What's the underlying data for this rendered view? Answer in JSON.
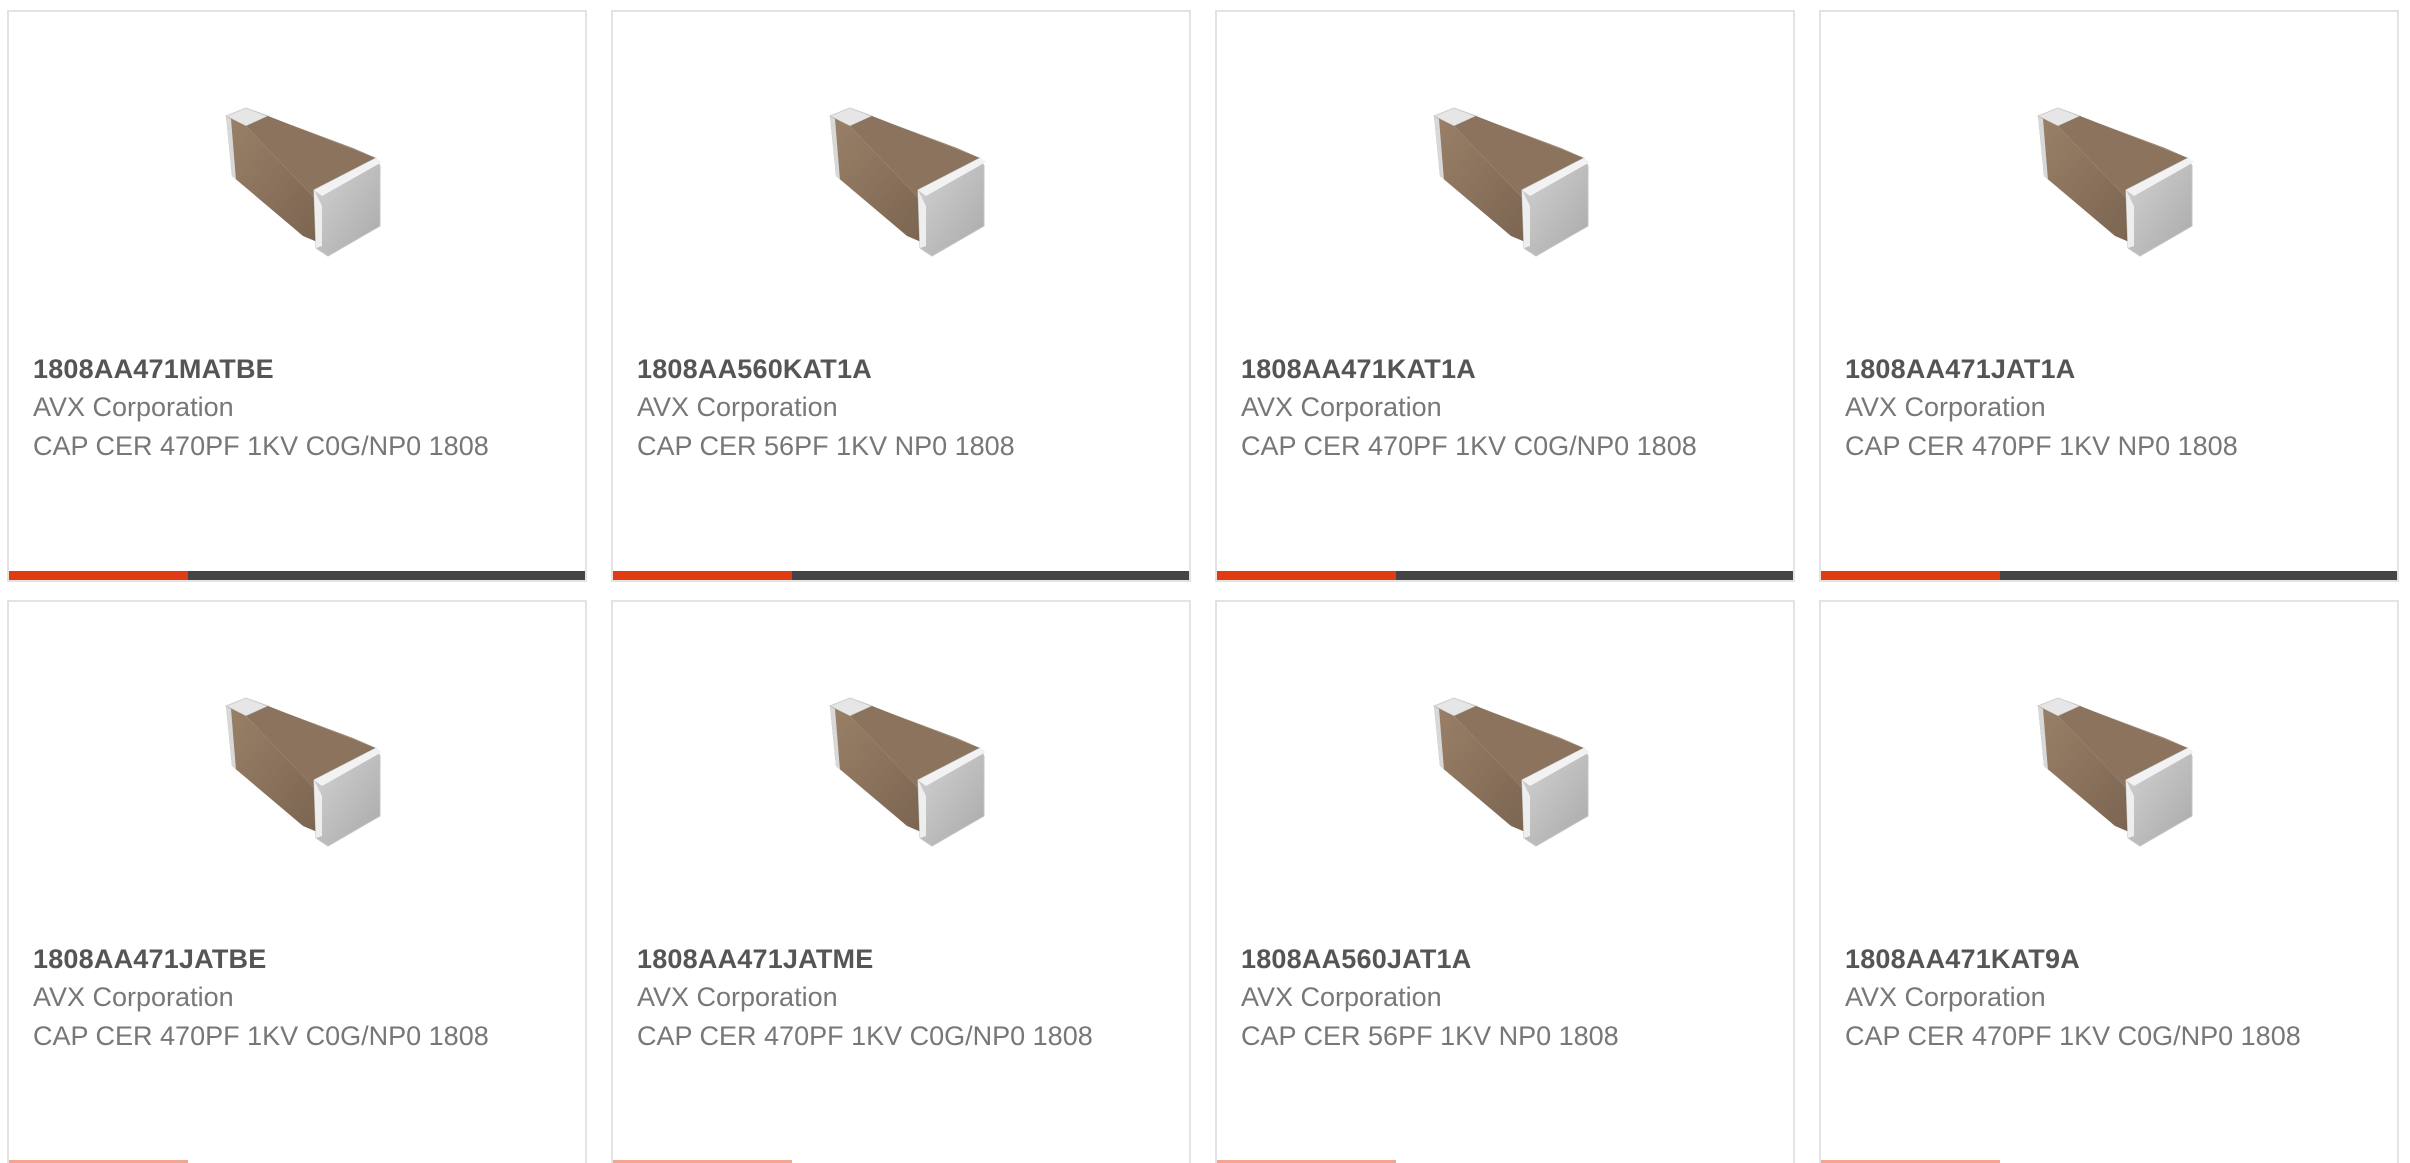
{
  "products": [
    {
      "part": "1808AA471MATBE",
      "manufacturer": "AVX Corporation",
      "description": "CAP CER 470PF 1KV C0G/NP0 1808",
      "icon": "capacitor-chip-image",
      "progress_fraction": 0.31
    },
    {
      "part": "1808AA560KAT1A",
      "manufacturer": "AVX Corporation",
      "description": "CAP CER 56PF 1KV NP0 1808",
      "icon": "capacitor-chip-image",
      "progress_fraction": 0.31
    },
    {
      "part": "1808AA471KAT1A",
      "manufacturer": "AVX Corporation",
      "description": "CAP CER 470PF 1KV C0G/NP0 1808",
      "icon": "capacitor-chip-image",
      "progress_fraction": 0.31
    },
    {
      "part": "1808AA471JAT1A",
      "manufacturer": "AVX Corporation",
      "description": "CAP CER 470PF 1KV NP0 1808",
      "icon": "capacitor-chip-image",
      "progress_fraction": 0.31
    },
    {
      "part": "1808AA471JATBE",
      "manufacturer": "AVX Corporation",
      "description": "CAP CER 470PF 1KV C0G/NP0 1808",
      "icon": "capacitor-chip-image",
      "progress_fraction": 0.31
    },
    {
      "part": "1808AA471JATME",
      "manufacturer": "AVX Corporation",
      "description": "CAP CER 470PF 1KV C0G/NP0 1808",
      "icon": "capacitor-chip-image",
      "progress_fraction": 0.31
    },
    {
      "part": "1808AA560JAT1A",
      "manufacturer": "AVX Corporation",
      "description": "CAP CER 56PF 1KV NP0 1808",
      "icon": "capacitor-chip-image",
      "progress_fraction": 0.31
    },
    {
      "part": "1808AA471KAT9A",
      "manufacturer": "AVX Corporation",
      "description": "CAP CER 470PF 1KV C0G/NP0 1808",
      "icon": "capacitor-chip-image",
      "progress_fraction": 0.31
    }
  ],
  "colors": {
    "accent": "#e23b12",
    "bar_track": "#444444",
    "card_border": "#e3e3e3",
    "part_text": "#555555",
    "body_text": "#777777"
  }
}
